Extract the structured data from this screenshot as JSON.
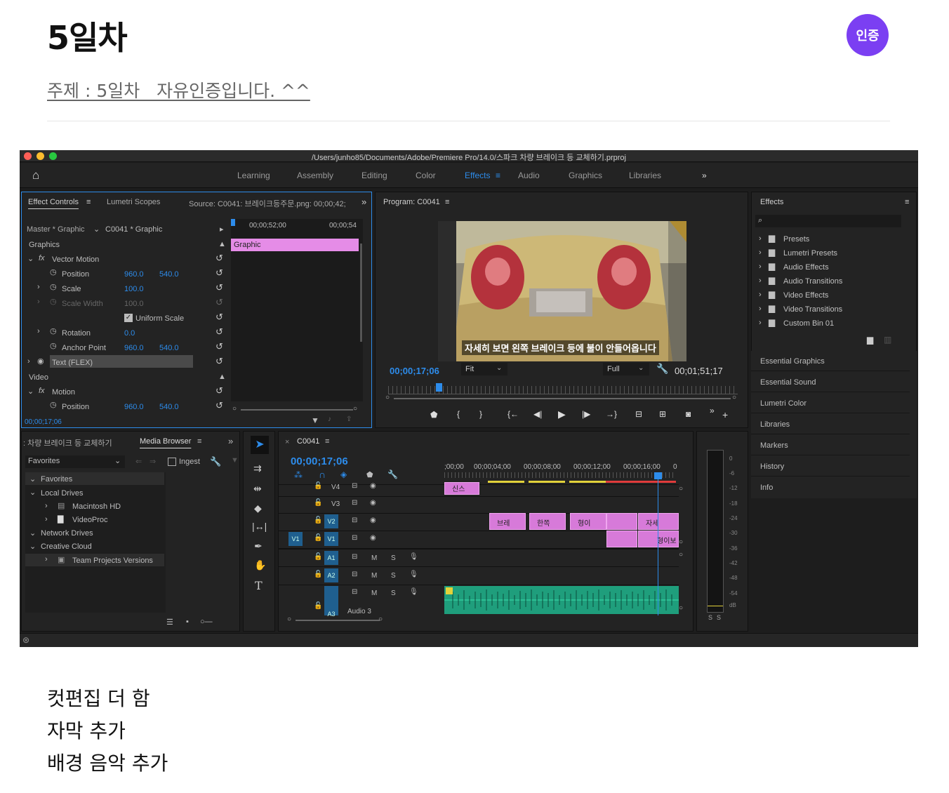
{
  "post": {
    "title": "5일차",
    "badge": "인증",
    "subject": "주제 : 5일차   자유인증입니다. ^^",
    "lines": [
      "컷편집 더 함",
      "자막 추가",
      "배경 음악 추가"
    ]
  },
  "premiere": {
    "window_title": "/Users/junho85/Documents/Adobe/Premiere Pro/14.0/스파크 차량 브레이크 등 교체하기.prproj",
    "workspaces": [
      "Learning",
      "Assembly",
      "Editing",
      "Color",
      "Effects",
      "Audio",
      "Graphics",
      "Libraries"
    ],
    "active_workspace": "Effects",
    "effect_controls": {
      "tabs": [
        "Effect Controls",
        "Lumetri Scopes"
      ],
      "source": "Source: C0041: 브레이크등주문.png: 00;00;42;",
      "master": "Master * Graphic",
      "clip": "C0041 * Graphic",
      "ruler": [
        "00;00;52;00",
        "00;00;54"
      ],
      "graphic_bar": "Graphic",
      "rows": [
        {
          "label": "Graphics"
        },
        {
          "label": "Vector Motion"
        },
        {
          "label": "Position",
          "v1": "960.0",
          "v2": "540.0"
        },
        {
          "label": "Scale",
          "v1": "100.0"
        },
        {
          "label": "Scale Width",
          "v1": "100.0"
        },
        {
          "label": "Uniform Scale"
        },
        {
          "label": "Rotation",
          "v1": "0.0"
        },
        {
          "label": "Anchor Point",
          "v1": "960.0",
          "v2": "540.0"
        },
        {
          "label": "Text (FLEX)"
        },
        {
          "label": "Video"
        },
        {
          "label": "Motion"
        },
        {
          "label": "Position",
          "v1": "960.0",
          "v2": "540.0"
        }
      ],
      "timecode": "00;00;17;06"
    },
    "program": {
      "title": "Program: C0041",
      "subtitle": "자세히 보면 왼쪽 브레이크 등에 불이 안들어옵니다",
      "timecode": "00;00;17;06",
      "fit": "Fit",
      "quality": "Full",
      "duration": "00;01;51;17"
    },
    "effects_panel": {
      "title": "Effects",
      "items": [
        "Presets",
        "Lumetri Presets",
        "Audio Effects",
        "Audio Transitions",
        "Video Effects",
        "Video Transitions",
        "Custom Bin 01"
      ],
      "side_panels": [
        "Essential Graphics",
        "Essential Sound",
        "Lumetri Color",
        "Libraries",
        "Markers",
        "History",
        "Info"
      ]
    },
    "media_browser": {
      "tabs": [
        ": 차량 브레이크 등 교체하기",
        "Media Browser"
      ],
      "favorites": "Favorites",
      "ingest": "Ingest",
      "tree": [
        "Favorites",
        "Local Drives",
        "Macintosh HD",
        "VideoProc",
        "Network Drives",
        "Creative Cloud",
        "Team Projects Versions"
      ]
    },
    "timeline": {
      "tab": "C0041",
      "timecode": "00;00;17;06",
      "ruler": [
        ";00;00",
        "00;00;04;00",
        "00;00;08;00",
        "00;00;12;00",
        "00;00;16;00",
        "0"
      ],
      "tracks": [
        "V4",
        "V3",
        "V2",
        "V1",
        "A1",
        "A2",
        "A3"
      ],
      "source_patch": "V1",
      "audio_label": "Audio 3",
      "clips_v2": [
        "브레",
        "한쪽",
        "형이",
        "",
        "자세"
      ],
      "clips_v1": [
        "",
        "형이보"
      ],
      "clip_v4": "신스"
    },
    "meter": {
      "scale": [
        "0",
        "-6",
        "-12",
        "-18",
        "-24",
        "-30",
        "-36",
        "-42",
        "-48",
        "-54",
        "dB"
      ],
      "solo": [
        "S",
        "S"
      ]
    }
  }
}
